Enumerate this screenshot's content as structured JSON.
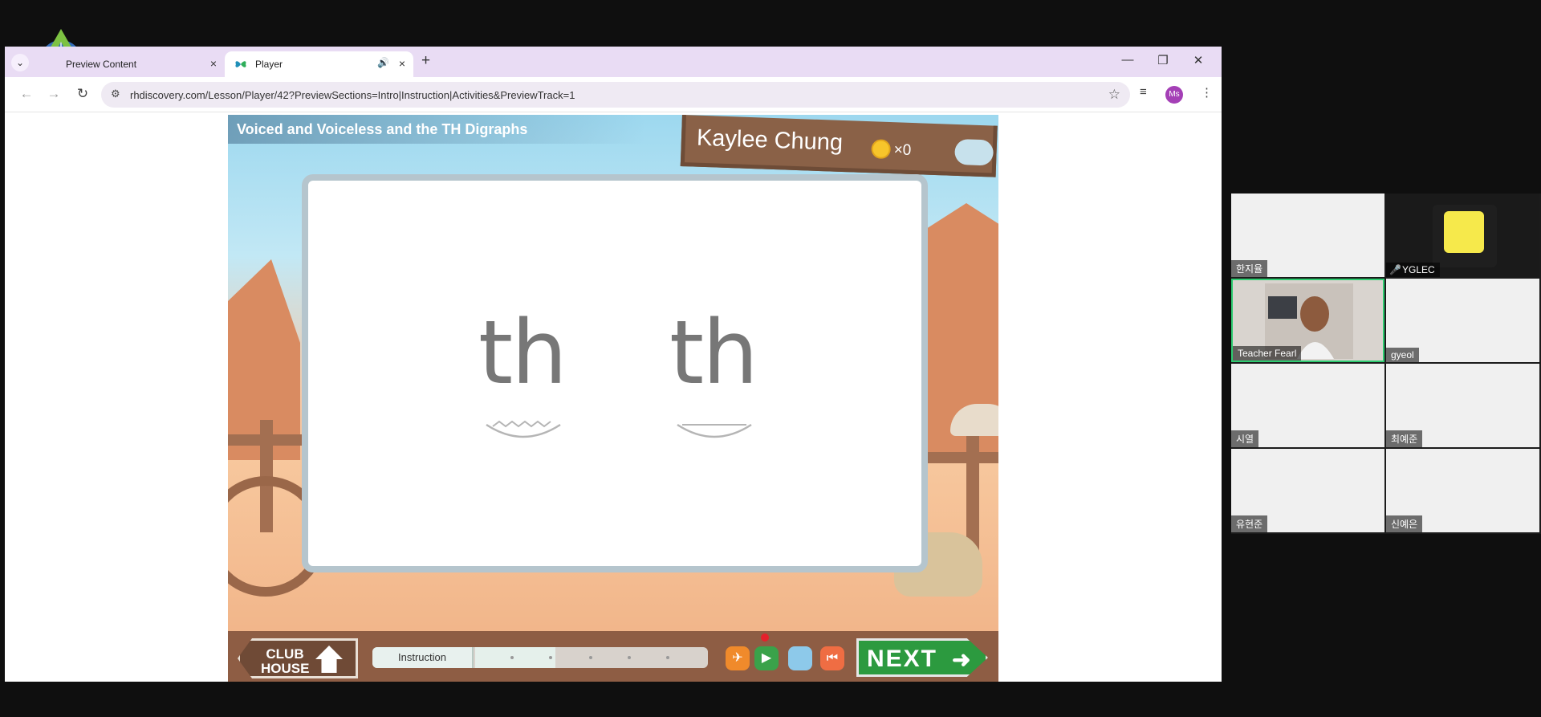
{
  "browser": {
    "tabs": [
      {
        "title": "Preview Content",
        "close": "×"
      },
      {
        "title": "Player",
        "audio": "🔊",
        "close": "×"
      }
    ],
    "new_tab": "+",
    "tab_list": "⌄",
    "window_controls": {
      "minimize": "—",
      "restore": "❐",
      "close": "✕"
    },
    "nav": {
      "back": "←",
      "forward": "→",
      "reload": "↻"
    },
    "url": "rhdiscovery.com/Lesson/Player/42?PreviewSections=Intro|Instruction|Activities&PreviewTrack=1",
    "site_info_icon": "⚙",
    "bookmark": "☆",
    "media_icon": "≡",
    "profile_initials": "Ms",
    "menu": "⋮"
  },
  "lesson": {
    "title": "Voiced and Voiceless and the TH Digraphs",
    "student_name": "Kaylee Chung",
    "coin_count": "×0",
    "digraphs": [
      "th",
      "th"
    ],
    "glyph_icons": [
      "voiced-zigzag-icon",
      "voiceless-line-icon"
    ]
  },
  "controls": {
    "clubhouse_label_1": "CLUB",
    "clubhouse_label_2": "HOUSE",
    "progress_section": "Instruction",
    "progress_fraction": 0.24,
    "next_label": "NEXT",
    "next_arrow": "➜",
    "buttons": [
      {
        "name": "replay-bird-button",
        "glyph": "✈",
        "color": "#f08a2b"
      },
      {
        "name": "play-button",
        "glyph": "▶",
        "color": "#3aa24a"
      },
      {
        "name": "stop-button",
        "glyph": "",
        "color": "#8dc9ea"
      },
      {
        "name": "restart-button",
        "glyph": "⏮",
        "color": "#ef6d43"
      }
    ]
  },
  "call": {
    "participants": [
      {
        "name": "한지율",
        "video": false
      },
      {
        "name": "YGLEC",
        "video": false,
        "muted": true,
        "muted_icon": "🎤"
      },
      {
        "name": "Teacher Fearl",
        "video": true,
        "active": true
      },
      {
        "name": "gyeol",
        "video": false
      },
      {
        "name": "시열",
        "video": false
      },
      {
        "name": "최예준",
        "video": false
      },
      {
        "name": "유현준",
        "video": false
      },
      {
        "name": "신예은",
        "video": false
      }
    ]
  }
}
